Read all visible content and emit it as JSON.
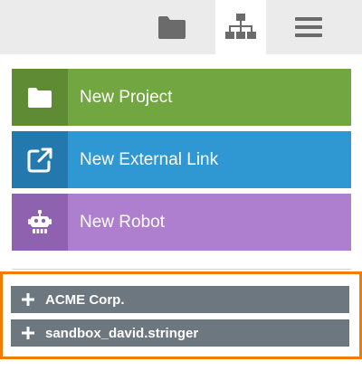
{
  "tabs": [
    {
      "icon": "folder-icon",
      "active": false
    },
    {
      "icon": "sitemap-icon",
      "active": true
    },
    {
      "icon": "hamburger-menu-icon",
      "active": false
    }
  ],
  "actions": {
    "new_project": {
      "label": "New Project",
      "icon": "folder-icon",
      "color": "#72a641",
      "icon_bg": "#5e8b33"
    },
    "new_external_link": {
      "label": "New External Link",
      "icon": "external-link-icon",
      "color": "#2f97d1",
      "icon_bg": "#2379ad"
    },
    "new_robot": {
      "label": "New Robot",
      "icon": "robot-icon",
      "color": "#ae7fcf",
      "icon_bg": "#8e62ae"
    }
  },
  "organizations": [
    {
      "name": "ACME Corp.",
      "icon": "plus-icon"
    },
    {
      "name": "sandbox_david.stringer",
      "icon": "plus-icon"
    }
  ],
  "colors": {
    "highlight_border": "#f07d00",
    "org_item_bg": "#6d7780",
    "tabbar_bg": "#ebebeb",
    "icon_gray": "#6b6b6b"
  }
}
